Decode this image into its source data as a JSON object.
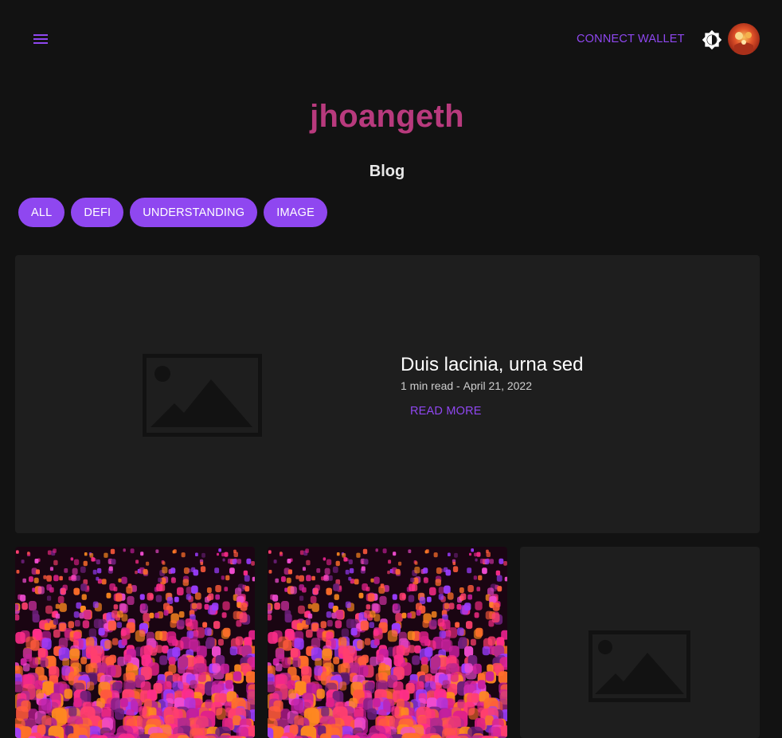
{
  "header": {
    "menu_icon": "hamburger-menu-icon",
    "connect_label": "CONNECT WALLET",
    "theme_icon": "brightness-toggle-icon",
    "avatar_icon": "user-avatar"
  },
  "site": {
    "title": "jhoangeth"
  },
  "blog": {
    "heading": "Blog",
    "filters": [
      "ALL",
      "DEFI",
      "UNDERSTANDING",
      "IMAGE"
    ]
  },
  "featured": {
    "title": "Duis lacinia, urna sed",
    "read_time": "1 min read",
    "separator": " - ",
    "date": "April 21, 2022",
    "read_more_label": "READ MORE",
    "image_icon": "image-placeholder-icon"
  },
  "cards": [
    {
      "image": "lanterns-photo"
    },
    {
      "image": "lanterns-photo"
    },
    {
      "image": "image-placeholder-icon"
    }
  ],
  "colors": {
    "background": "#121212",
    "surface": "#1e1e1e",
    "accent": "#8f47f0",
    "title": "#b83a7d"
  }
}
